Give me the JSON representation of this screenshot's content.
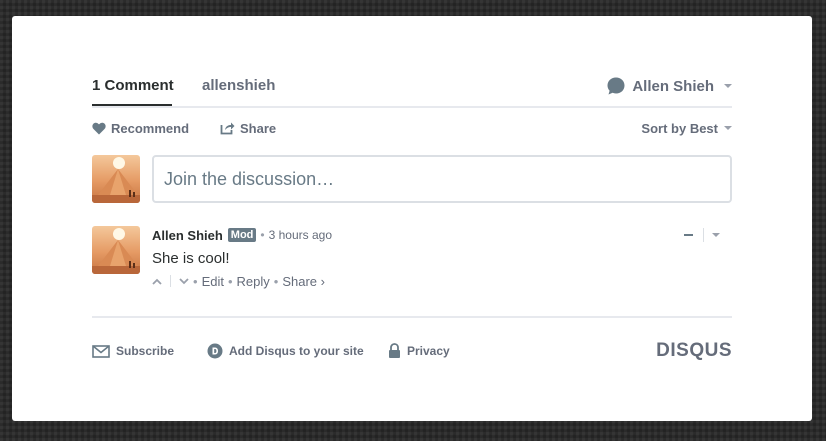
{
  "nav": {
    "comments_tab": "1 Comment",
    "community_tab": "allenshieh",
    "user_name": "Allen Shieh"
  },
  "actions": {
    "recommend": "Recommend",
    "share": "Share",
    "sort": "Sort by Best"
  },
  "composer": {
    "placeholder": "Join the discussion…",
    "value": ""
  },
  "comment": {
    "author": "Allen Shieh",
    "badge": "Mod",
    "time": "3 hours ago",
    "body": "She is cool!",
    "edit": "Edit",
    "reply": "Reply",
    "share": "Share ›"
  },
  "footer": {
    "subscribe": "Subscribe",
    "add_disqus": "Add Disqus to your site",
    "privacy": "Privacy",
    "logo": "DISQUS"
  },
  "icons": {
    "heart": "heart-icon",
    "share": "share-icon",
    "bubble": "speech-bubble-icon",
    "envelope": "envelope-icon",
    "disqus_d": "disqus-d-icon",
    "lock": "lock-icon",
    "up": "chevron-up-icon",
    "down": "chevron-down-icon"
  },
  "colors": {
    "primary_text": "#2a2e2e",
    "muted_text": "#656c7a",
    "badge_bg": "#687a86",
    "border": "#dbdfe4",
    "background": "#2b2b2b"
  }
}
